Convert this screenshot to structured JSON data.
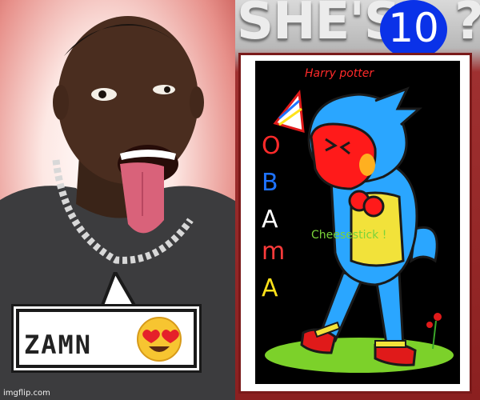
{
  "meme": {
    "title": "SHE'S",
    "question_mark": "?",
    "badge": "10",
    "bubble_text": "ZAMN",
    "emoji": "heart-eyes-icon",
    "watermark": "imgflip.com"
  },
  "drawing": {
    "top_text": "Harry potter",
    "obama_letters": [
      {
        "char": "O",
        "color": "#ff2a2a"
      },
      {
        "char": "B",
        "color": "#1e73ff"
      },
      {
        "char": "A",
        "color": "#ffffff"
      },
      {
        "char": "m",
        "color": "#ff3b3b"
      },
      {
        "char": "A",
        "color": "#ffe21a"
      }
    ],
    "side_text": "Cheesestick !",
    "colors": {
      "body": "#2aa6ff",
      "face": "#ff1a1a",
      "shirt": "#f2e23a",
      "grass": "#7cd12a"
    }
  }
}
